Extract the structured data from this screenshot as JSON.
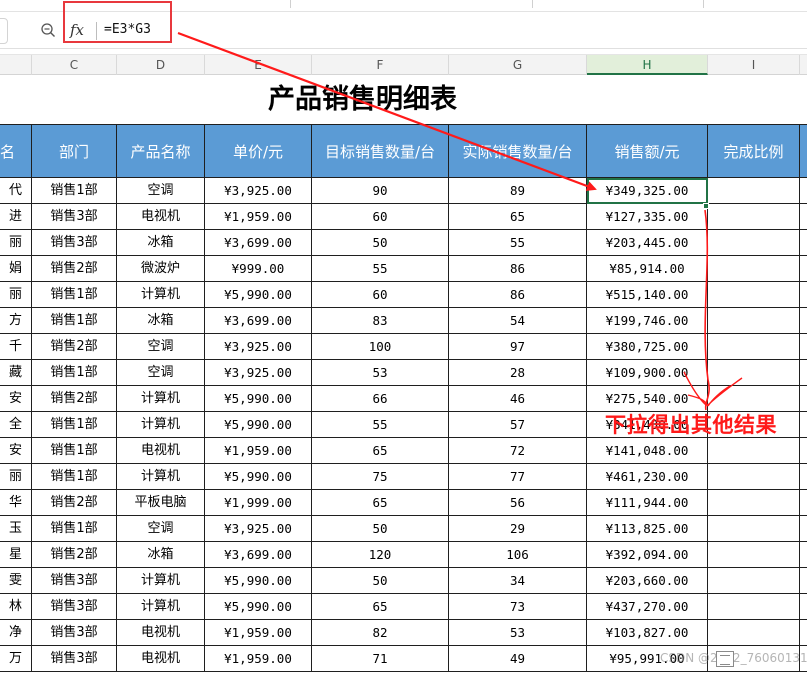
{
  "formula_bar": {
    "fx_label": "fx",
    "formula": "=E3*G3"
  },
  "columns": [
    "C",
    "D",
    "E",
    "F",
    "G",
    "H",
    "I"
  ],
  "active_column": "H",
  "title": "产品销售明细表",
  "headers": {
    "name": "名",
    "dept": "部门",
    "product": "产品名称",
    "price": "单价/元",
    "target": "目标销售数量/台",
    "actual": "实际销售数量/台",
    "sales": "销售额/元",
    "ratio": "完成比例"
  },
  "rows": [
    {
      "name": "代",
      "dept": "销售1部",
      "product": "空调",
      "price": "¥3,925.00",
      "target": "90",
      "actual": "89",
      "sales": "¥349,325.00"
    },
    {
      "name": "进",
      "dept": "销售3部",
      "product": "电视机",
      "price": "¥1,959.00",
      "target": "60",
      "actual": "65",
      "sales": "¥127,335.00"
    },
    {
      "name": "丽",
      "dept": "销售3部",
      "product": "冰箱",
      "price": "¥3,699.00",
      "target": "50",
      "actual": "55",
      "sales": "¥203,445.00"
    },
    {
      "name": "娟",
      "dept": "销售2部",
      "product": "微波炉",
      "price": "¥999.00",
      "target": "55",
      "actual": "86",
      "sales": "¥85,914.00"
    },
    {
      "name": "丽",
      "dept": "销售1部",
      "product": "计算机",
      "price": "¥5,990.00",
      "target": "60",
      "actual": "86",
      "sales": "¥515,140.00"
    },
    {
      "name": "方",
      "dept": "销售1部",
      "product": "冰箱",
      "price": "¥3,699.00",
      "target": "83",
      "actual": "54",
      "sales": "¥199,746.00"
    },
    {
      "name": "千",
      "dept": "销售2部",
      "product": "空调",
      "price": "¥3,925.00",
      "target": "100",
      "actual": "97",
      "sales": "¥380,725.00"
    },
    {
      "name": "藏",
      "dept": "销售1部",
      "product": "空调",
      "price": "¥3,925.00",
      "target": "53",
      "actual": "28",
      "sales": "¥109,900.00"
    },
    {
      "name": "安",
      "dept": "销售2部",
      "product": "计算机",
      "price": "¥5,990.00",
      "target": "66",
      "actual": "46",
      "sales": "¥275,540.00"
    },
    {
      "name": "全",
      "dept": "销售1部",
      "product": "计算机",
      "price": "¥5,990.00",
      "target": "55",
      "actual": "57",
      "sales": "¥341,430.00"
    },
    {
      "name": "安",
      "dept": "销售1部",
      "product": "电视机",
      "price": "¥1,959.00",
      "target": "65",
      "actual": "72",
      "sales": "¥141,048.00"
    },
    {
      "name": "丽",
      "dept": "销售1部",
      "product": "计算机",
      "price": "¥5,990.00",
      "target": "75",
      "actual": "77",
      "sales": "¥461,230.00"
    },
    {
      "name": "华",
      "dept": "销售2部",
      "product": "平板电脑",
      "price": "¥1,999.00",
      "target": "65",
      "actual": "56",
      "sales": "¥111,944.00"
    },
    {
      "name": "玉",
      "dept": "销售1部",
      "product": "空调",
      "price": "¥3,925.00",
      "target": "50",
      "actual": "29",
      "sales": "¥113,825.00"
    },
    {
      "name": "星",
      "dept": "销售2部",
      "product": "冰箱",
      "price": "¥3,699.00",
      "target": "120",
      "actual": "106",
      "sales": "¥392,094.00"
    },
    {
      "name": "雯",
      "dept": "销售3部",
      "product": "计算机",
      "price": "¥5,990.00",
      "target": "50",
      "actual": "34",
      "sales": "¥203,660.00"
    },
    {
      "name": "林",
      "dept": "销售3部",
      "product": "计算机",
      "price": "¥5,990.00",
      "target": "65",
      "actual": "73",
      "sales": "¥437,270.00"
    },
    {
      "name": "净",
      "dept": "销售3部",
      "product": "电视机",
      "price": "¥1,959.00",
      "target": "82",
      "actual": "53",
      "sales": "¥103,827.00"
    },
    {
      "name": "万",
      "dept": "销售3部",
      "product": "电视机",
      "price": "¥1,959.00",
      "target": "71",
      "actual": "49",
      "sales": "¥95,991.00"
    }
  ],
  "annotation": "下拉得出其他结果",
  "watermark": "CSDN @2302_76060131",
  "colors": {
    "header_bg": "#5b9bd5",
    "annotation": "#ff1a1a",
    "selection": "#217346",
    "highlight_box": "#e8383d"
  }
}
